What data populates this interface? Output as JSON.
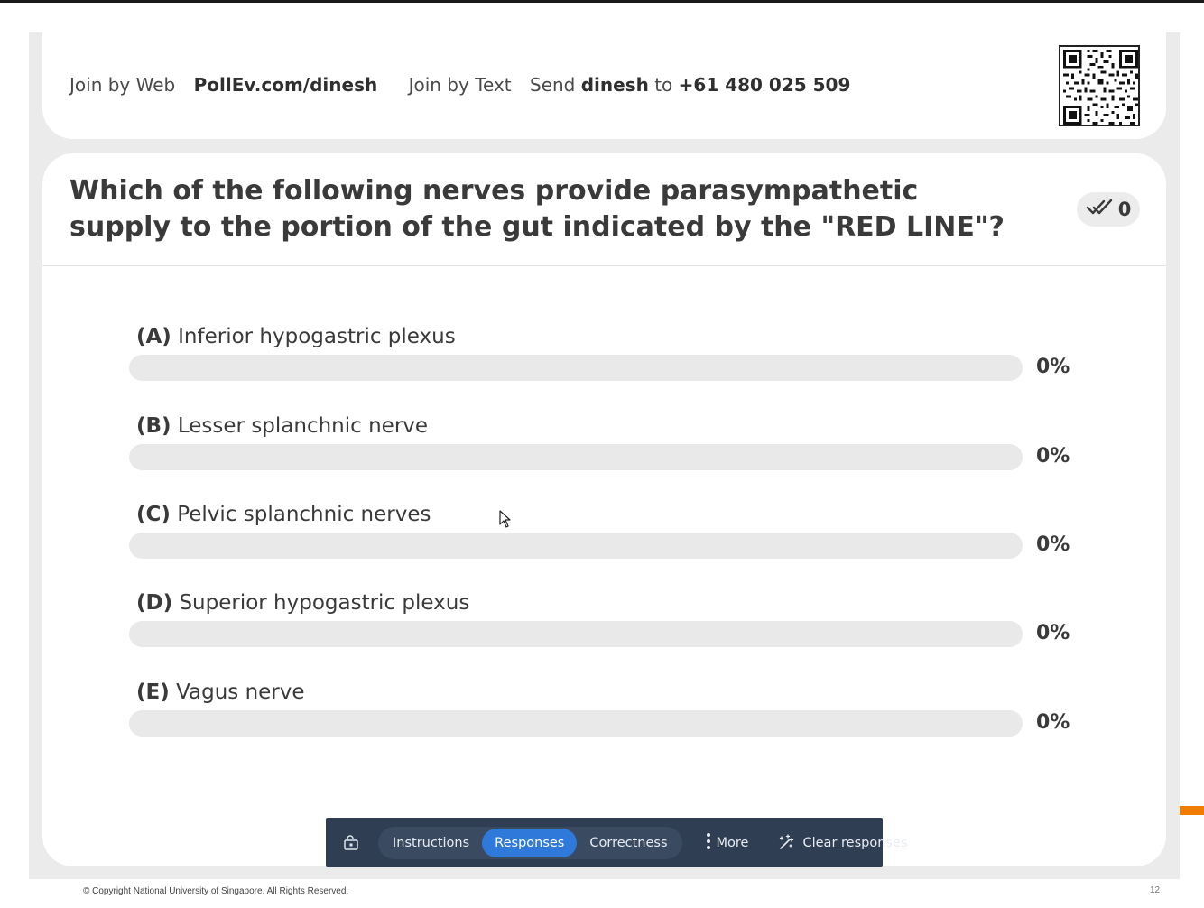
{
  "join": {
    "web_prefix": "Join by Web",
    "web_url": "PollEv.com/dinesh",
    "text_prefix": "Join by Text",
    "send_word": "Send",
    "keyword": "dinesh",
    "to_word": "to",
    "phone": "+61 480 025 509"
  },
  "question": {
    "text": "Which of the following nerves provide parasympathetic supply to the portion of the gut indicated by the \"RED LINE\"?",
    "response_count": "0"
  },
  "options": [
    {
      "letter": "(A)",
      "text": "Inferior hypogastric plexus",
      "percent": "0%",
      "fraction": 0
    },
    {
      "letter": "(B)",
      "text": "Lesser splanchnic nerve",
      "percent": "0%",
      "fraction": 0
    },
    {
      "letter": "(C)",
      "text": "Pelvic splanchnic nerves",
      "percent": "0%",
      "fraction": 0
    },
    {
      "letter": "(D)",
      "text": "Superior hypogastric plexus",
      "percent": "0%",
      "fraction": 0
    },
    {
      "letter": "(E)",
      "text": "Vagus nerve",
      "percent": "0%",
      "fraction": 0
    }
  ],
  "toolbar": {
    "tabs": [
      "Instructions",
      "Responses",
      "Correctness"
    ],
    "active_tab": "Responses",
    "more_label": "More",
    "clear_label": "Clear responses"
  },
  "footer": {
    "copyright": "© Copyright National University of Singapore. All Rights Reserved.",
    "page_number": "12"
  },
  "colors": {
    "toolbar_bg": "#2f3e53",
    "active_tab": "#2e79d9",
    "bar_track": "#e9e9e9",
    "accent_orange": "#f07d00"
  },
  "icons": [
    "qr-code-icon",
    "responses-check-icon",
    "lock-screen-icon",
    "more-vertical-icon",
    "clear-sparkle-icon",
    "mouse-cursor-icon"
  ]
}
